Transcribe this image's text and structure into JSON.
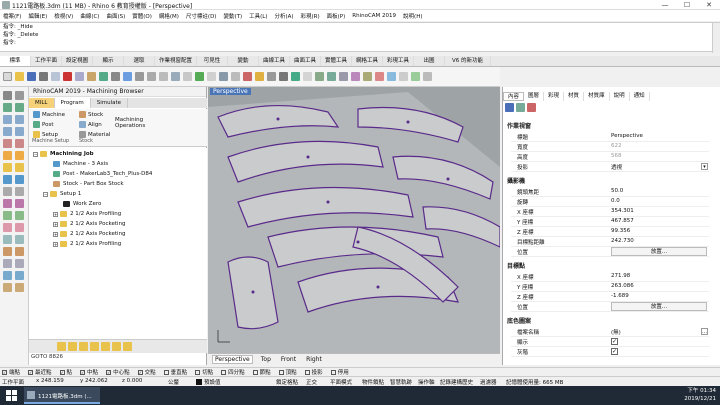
{
  "window": {
    "title": "1121電路板.3dm (11 MB) - Rhino 6 教育授權版 - [Perspective]",
    "controls": [
      "—",
      "☐",
      "✕"
    ]
  },
  "menu": [
    "檔案(F)",
    "編輯(E)",
    "檢視(V)",
    "曲線(C)",
    "曲面(S)",
    "實體(O)",
    "網格(M)",
    "尺寸標註(D)",
    "變動(T)",
    "工具(L)",
    "分析(A)",
    "彩現(R)",
    "面板(P)",
    "RhinoCAM 2019",
    "說明(H)"
  ],
  "command_history": [
    "指令: _Hide",
    "指令: _Delete",
    "指令:"
  ],
  "toolbar_tabs": [
    "標準",
    "工作平面",
    "設定視圖",
    "顯示",
    "選取",
    "作業視窗配置",
    "可見性",
    "變動",
    "曲線工具",
    "曲面工具",
    "實體工具",
    "網格工具",
    "彩現工具",
    "出圖",
    "V6 的新功能"
  ],
  "rhinocam": {
    "title": "RhinoCAM 2019 - Machining Browser",
    "mill_label": "MILL",
    "tabs": [
      "Program",
      "Simulate"
    ],
    "ribbon": {
      "machine": "Machine",
      "post": "Post",
      "setup": "Setup",
      "stock": "Stock",
      "align": "Align",
      "material": "Material",
      "machining_ops": "Machining",
      "machining_ops2": "Operations",
      "group_setup": "Machine Setup",
      "group_stock": "Stock"
    },
    "tree": {
      "root": "Machining Job",
      "machine": "Machine - 3 Axis",
      "post": "Post - MakerLab3_Tech_Plus-D84",
      "stock": "Stock - Part Box Stock",
      "setup": "Setup 1",
      "workzero": "Work Zero",
      "ops": [
        "2 1/2 Axis Profiling",
        "2 1/2 Axis Pocketing",
        "2 1/2 Axis Pocketing",
        "2 1/2 Axis Profiling"
      ]
    },
    "goto": "GOTO 8826"
  },
  "viewport": {
    "label": "Perspective",
    "tabs": [
      "Perspective",
      "Top",
      "Front",
      "Right"
    ]
  },
  "properties": {
    "tabs": [
      "內容",
      "圖層",
      "彩現",
      "材質",
      "材質庫",
      "說明",
      "通知"
    ],
    "section_view": "作業視窗",
    "title_label": "標題",
    "title_value": "Perspective",
    "width_label": "寬度",
    "width_value": "622",
    "height_label": "高度",
    "height_value": "568",
    "proj_label": "投影",
    "proj_value": "透視",
    "section_camera": "攝影機",
    "lens_label": "鏡頭焦距",
    "lens_value": "50.0",
    "rot_label": "旋轉",
    "rot_value": "0.0",
    "cx_label": "X 座標",
    "cx_value": "354.301",
    "cy_label": "Y 座標",
    "cy_value": "467.857",
    "cz_label": "Z 座標",
    "cz_value": "99.356",
    "dist_label": "目標點距離",
    "dist_value": "242.730",
    "pos_label": "位置",
    "place_btn": "放置...",
    "section_target": "目標點",
    "tx_label": "X 座標",
    "tx_value": "271.98",
    "ty_label": "Y 座標",
    "ty_value": "263.086",
    "tz_label": "Z 座標",
    "tz_value": "-1.689",
    "tpos_label": "位置",
    "tplace_btn": "放置...",
    "section_wallpaper": "底色圖案",
    "file_label": "檔案名稱",
    "file_value": "(無)",
    "show_label": "顯示",
    "gray_label": "灰階"
  },
  "osnap": [
    "端點",
    "最近點",
    "點",
    "中點",
    "中心點",
    "交點",
    "垂直點",
    "切點",
    "四分點",
    "節點",
    "頂點",
    "投影",
    "停用"
  ],
  "status": {
    "cplane": "工作平面",
    "x": "x 248.159",
    "y": "y 242.062",
    "z": "z 0.000",
    "unit": "公釐",
    "layer": "預設值",
    "items": [
      "鎖定格點",
      "正交",
      "平面模式",
      "物件鎖點",
      "智慧軌跡",
      "操作軸",
      "記錄建構歷史",
      "過濾器",
      "記憶體使用量: 665 MB"
    ]
  },
  "taskbar": {
    "item": "1121電路板.3dm (...",
    "time": "下午 01:34",
    "date": "2019/12/21"
  }
}
